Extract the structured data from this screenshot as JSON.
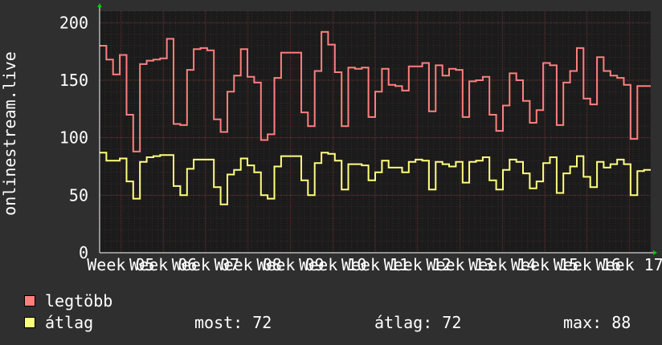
{
  "chart_data": {
    "type": "line",
    "ylabel": "onlinestream.live",
    "ylim": [
      0,
      210
    ],
    "yticks": [
      0,
      50,
      100,
      150,
      200
    ],
    "xtick_labels": [
      "Week 05",
      "Week 06",
      "Week 07",
      "Week 08",
      "Week 09",
      "Week 10",
      "Week 11",
      "Week 12",
      "Week 13",
      "Week 14",
      "Week 15",
      "Week 16",
      "Week 17"
    ],
    "grid": true,
    "series": [
      {
        "name": "legtöbb",
        "color": "#ff7f7f",
        "values": [
          180,
          168,
          155,
          172,
          120,
          88,
          164,
          167,
          168,
          169,
          186,
          112,
          111,
          159,
          177,
          178,
          176,
          116,
          105,
          140,
          154,
          177,
          153,
          148,
          98,
          103,
          152,
          174,
          174,
          174,
          122,
          110,
          158,
          192,
          181,
          157,
          110,
          161,
          160,
          161,
          118,
          140,
          160,
          146,
          145,
          141,
          162,
          162,
          165,
          123,
          163,
          154,
          160,
          159,
          118,
          149,
          150,
          153,
          120,
          106,
          128,
          156,
          150,
          132,
          113,
          124,
          165,
          163,
          111,
          148,
          158,
          178,
          134,
          129,
          170,
          158,
          154,
          152,
          146,
          99,
          145,
          145
        ]
      },
      {
        "name": "átlag",
        "color": "#ffff7f",
        "values": [
          87,
          80,
          80,
          82,
          62,
          47,
          79,
          83,
          84,
          85,
          85,
          58,
          50,
          73,
          81,
          81,
          81,
          57,
          42,
          68,
          72,
          82,
          76,
          70,
          50,
          47,
          75,
          84,
          84,
          84,
          63,
          50,
          78,
          87,
          86,
          80,
          55,
          77,
          77,
          76,
          63,
          70,
          80,
          74,
          74,
          70,
          79,
          81,
          80,
          55,
          79,
          77,
          75,
          79,
          61,
          79,
          80,
          83,
          63,
          55,
          72,
          81,
          79,
          69,
          56,
          62,
          78,
          83,
          52,
          69,
          75,
          84,
          66,
          57,
          79,
          74,
          77,
          81,
          77,
          50,
          71,
          72
        ]
      }
    ]
  },
  "legend": {
    "max_label": "legtöbb",
    "avg_label": "átlag",
    "stat_now": "most: 72",
    "stat_avg": "átlag: 72",
    "stat_max": "max: 88"
  }
}
